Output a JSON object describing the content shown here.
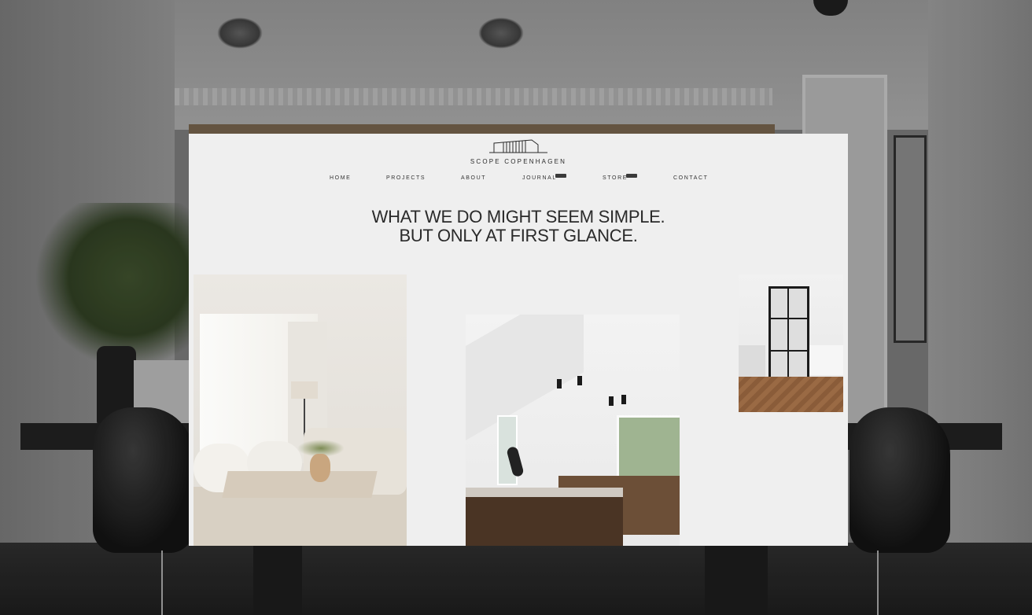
{
  "brand": {
    "name": "SCOPE COPENHAGEN",
    "logo_icon": "building-outline-icon"
  },
  "nav": {
    "items": [
      {
        "label": "HOME",
        "badge": false
      },
      {
        "label": "PROJECTS",
        "badge": false
      },
      {
        "label": "ABOUT",
        "badge": false
      },
      {
        "label": "JOURNAL",
        "badge": true
      },
      {
        "label": "STORE",
        "badge": true
      },
      {
        "label": "CONTACT",
        "badge": false
      }
    ]
  },
  "hero": {
    "line1": "WHAT WE DO MIGHT SEEM SIMPLE.",
    "line2": "BUT ONLY AT FIRST GLANCE."
  },
  "gallery": {
    "images": [
      {
        "subject": "living-room"
      },
      {
        "subject": "kitchen-attic"
      },
      {
        "subject": "bedroom-glass-door"
      }
    ]
  },
  "colors": {
    "page_bg": "#efefef",
    "text": "#2a2a2a",
    "backdrop": "#6f6f6f"
  }
}
